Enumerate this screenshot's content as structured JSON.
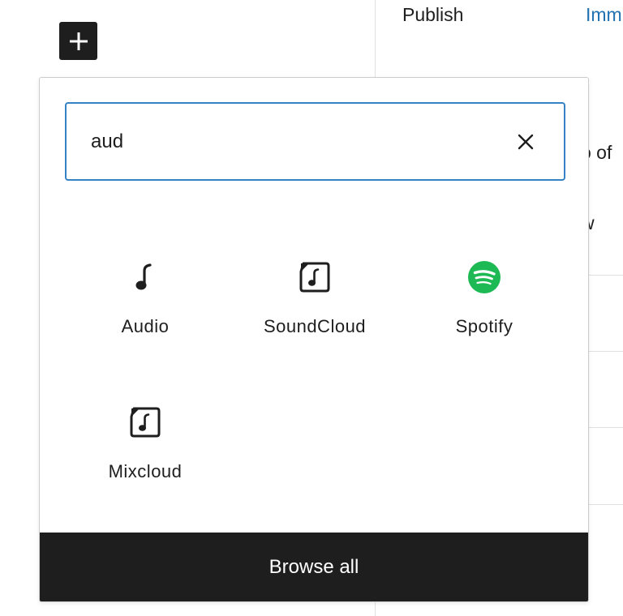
{
  "sidebar": {
    "publish_label": "Publish",
    "publish_value": "Imm",
    "peek_1": "o of",
    "peek_2": "w"
  },
  "toolbar": {
    "inserter_toggle_icon": "plus-icon"
  },
  "inserter": {
    "search": {
      "value": "aud",
      "clear_icon": "close-icon"
    },
    "blocks": [
      {
        "label": "Audio",
        "icon": "music-note-icon"
      },
      {
        "label": "SoundCloud",
        "icon": "embed-audio-icon"
      },
      {
        "label": "Spotify",
        "icon": "spotify-icon",
        "color": "#1db954"
      },
      {
        "label": "Mixcloud",
        "icon": "embed-audio-icon"
      }
    ],
    "browse_all_label": "Browse all"
  },
  "colors": {
    "accent": "#3582c4",
    "link": "#2271b1",
    "dark": "#1e1e1e",
    "spotify": "#1db954"
  }
}
